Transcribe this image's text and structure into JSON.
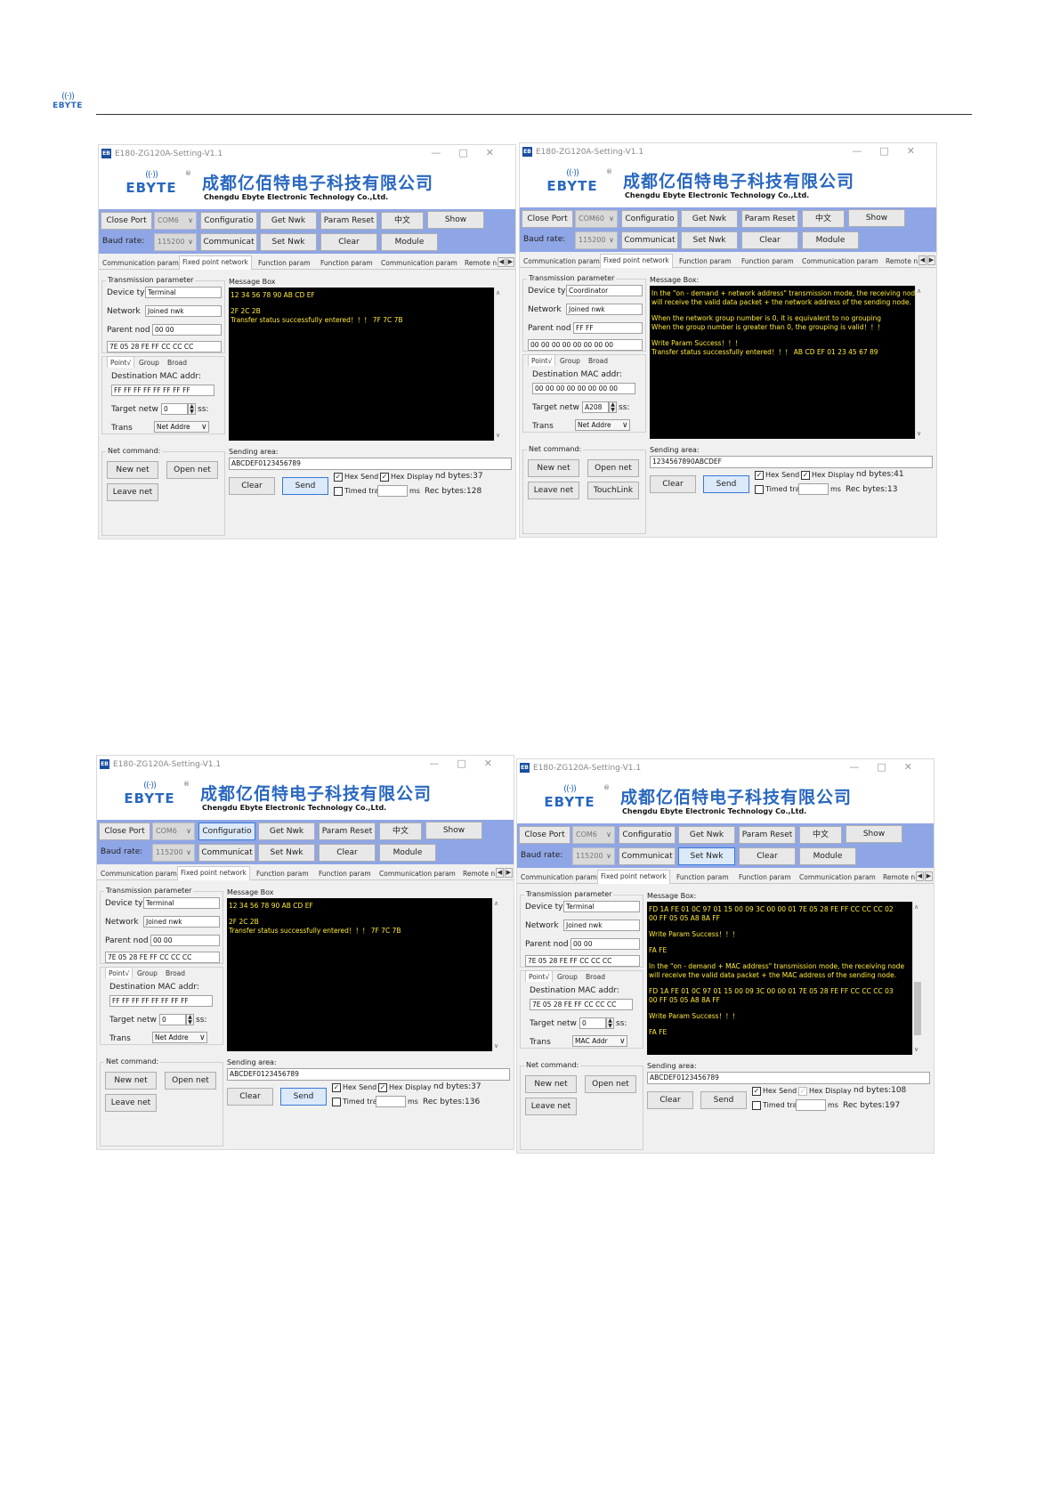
{
  "header": {
    "logo_text": "EBYTE"
  },
  "app": {
    "title": "E180-ZG120A-Setting-V1.1",
    "title_icon": "EB",
    "company_cn": "成都亿佰特电子科技有限公司",
    "company_en": "Chengdu Ebyte Electronic Technology Co.,Ltd.",
    "brand": "EBYTE"
  },
  "labels": {
    "close_port": "Close Port",
    "baud_rate": "Baud rate:",
    "configuration": "Configuratio",
    "communicat": "Communicat",
    "get_nwk": "Get Nwk",
    "set_nwk": "Set Nwk",
    "param_reset": "Param Reset",
    "clear": "Clear",
    "lang": "中文",
    "module": "Module",
    "show": "Show",
    "tabs": [
      "Communication param",
      "Fixed point network",
      "Function param",
      "Function param",
      "Communication param",
      "Remote n"
    ],
    "transmission_param": "Transmission parameter",
    "device_type": "Device typ",
    "network": "Network",
    "parent_node": "Parent nod",
    "point": "Point√",
    "group": "Group",
    "broad": "Broad",
    "dest_mac": "Destination MAC addr:",
    "target_netw": "Target netw",
    "target_ss": "ss:",
    "trans": "Trans",
    "message_box": "Message Box",
    "message_box_colon": "Message Box:",
    "net_command": "Net command:",
    "new_net": "New net",
    "open_net": "Open net",
    "leave_net": "Leave net",
    "touchlink": "TouchLink",
    "sending_area": "Sending area:",
    "send": "Send",
    "hex_send": "Hex Send",
    "hex_display": "Hex Display",
    "timed_tran": "Timed tran",
    "ms": "ms"
  },
  "windows": {
    "tl": {
      "com": "COM6",
      "baud": "115200",
      "device_type": "Terminal",
      "network": "Joined nwk",
      "parent": "00 00",
      "addr_field": "7E 05 28 FE FF CC CC CC",
      "dest_mac": "FF FF FF FF FF FF FF FF",
      "target": "0",
      "trans_mode": "Net Addre",
      "msg": [
        "12 34 56 78 90 AB CD EF",
        "",
        "2F 2C 2B",
        "Transfer status successfully entered！！！ 7F 7C 7B"
      ],
      "sending": "ABCDEF0123456789",
      "send_bytes": "nd bytes:37",
      "rec_bytes": "Rec bytes:128"
    },
    "tr": {
      "com": "COM60",
      "baud": "115200",
      "device_type": "Coordinator",
      "network": "Joined nwk",
      "parent": "FF FF",
      "addr_field": "00 00 00 00 00 00 00 00",
      "dest_mac": "00 00 00 00 00 00 00 00",
      "target": "A208",
      "trans_mode": "Net Addre",
      "msg": [
        "In the \"on - demand + network address\" transmission mode, the receiving node",
        "will receive the valid data packet + the network address of the sending node.",
        "",
        "When the network group number is 0, it is equivalent to no grouping",
        "When the group number is greater than 0, the grouping is valid！！！",
        "",
        "Write Param Success！！！",
        "Transfer status successfully entered！！！ AB CD EF 01 23 45 67 89"
      ],
      "sending": "1234567890ABCDEF",
      "send_bytes": "nd bytes:41",
      "rec_bytes": "Rec bytes:13"
    },
    "bl": {
      "com": "COM6",
      "baud": "115200",
      "device_type": "Terminal",
      "network": "Joined nwk",
      "parent": "00 00",
      "addr_field": "7E 05 28 FE FF CC CC CC",
      "dest_mac": "FF FF FF FF FF FF FF FF",
      "target": "0",
      "trans_mode": "Net Addre",
      "msg": [
        "12 34 56 78 90 AB CD EF",
        "",
        "2F 2C 2B",
        "Transfer status successfully entered！！！ 7F 7C 7B"
      ],
      "sending": "ABCDEF0123456789",
      "send_bytes": "nd bytes:37",
      "rec_bytes": "Rec bytes:136"
    },
    "br": {
      "com": "COM6",
      "baud": "115200",
      "device_type": "Terminal",
      "network": "Joined nwk",
      "parent": "00 00",
      "addr_field": "7E 05 28 FE FF CC CC CC",
      "dest_mac": "7E 05 28 FE FF CC CC CC",
      "target": "0",
      "trans_mode": "MAC Addr",
      "msg": [
        "FD 1A FE 01 0C 97 01 15 00 09 3C 00 00 01 7E 05 28 FE FF CC CC CC 02",
        "00 FF 05 05 A8 8A FF",
        "",
        "Write Param Success！！！",
        "",
        "FA FE",
        "",
        "In the \"on - demand + MAC address\" transmission mode, the receiving node",
        "will receive the valid data packet + the MAC address of the sending node.",
        "",
        "FD 1A FE 01 0C 97 01 15 00 09 3C 00 00 01 7E 05 28 FE FF CC CC CC 03",
        "00 FF 05 05 A8 8A FF",
        "",
        "Write Param Success！！！",
        "",
        "FA FE"
      ],
      "sending": "ABCDEF0123456789",
      "send_bytes": "nd bytes:108",
      "rec_bytes": "Rec bytes:197"
    }
  }
}
